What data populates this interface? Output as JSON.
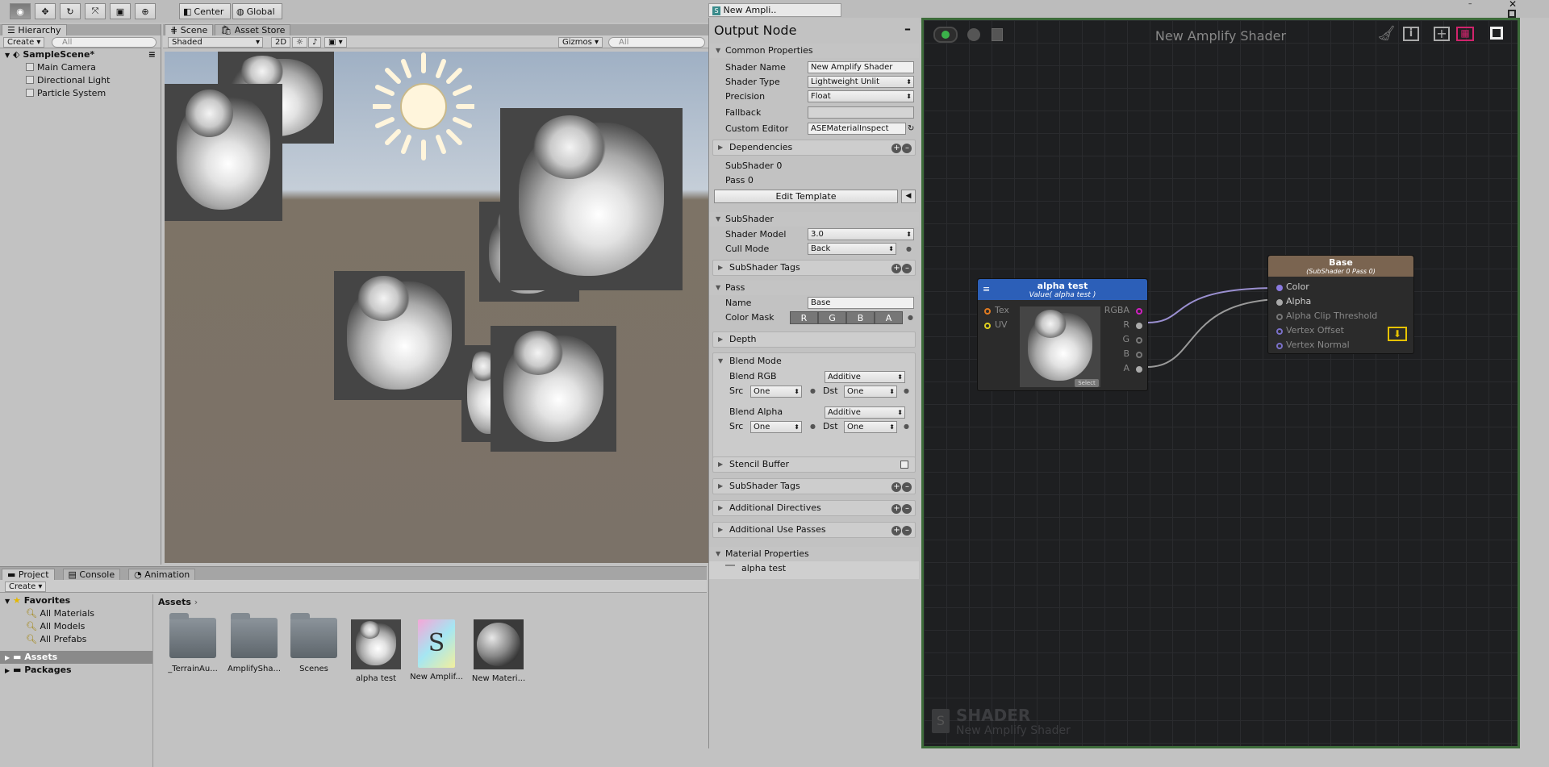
{
  "toolbar": {
    "center": "Center",
    "global": "Global"
  },
  "hierarchy": {
    "tab": "Hierarchy",
    "create": "Create",
    "search_placeholder": "All",
    "scene": "SampleScene*",
    "items": [
      "Main Camera",
      "Directional Light",
      "Particle System"
    ]
  },
  "scene": {
    "tabs": [
      "Scene",
      "Asset Store"
    ],
    "shading": "Shaded",
    "mode2d": "2D",
    "gizmos": "Gizmos",
    "search_placeholder": "All"
  },
  "ase_window": {
    "tab": "New Ampli.."
  },
  "output_node": {
    "title": "Output Node",
    "common_properties": "Common Properties",
    "shader_name_label": "Shader Name",
    "shader_name": "New Amplify Shader",
    "shader_type_label": "Shader Type",
    "shader_type": "Lightweight Unlit",
    "precision_label": "Precision",
    "precision": "Float",
    "fallback_label": "Fallback",
    "fallback": "",
    "custom_editor_label": "Custom Editor",
    "custom_editor": "ASEMaterialInspect",
    "dependencies": "Dependencies",
    "subshader_info": "SubShader 0",
    "pass_info": "Pass 0",
    "edit_template": "Edit Template",
    "subshader": "SubShader",
    "shader_model_label": "Shader Model",
    "shader_model": "3.0",
    "cull_mode_label": "Cull Mode",
    "cull_mode": "Back",
    "subshader_tags": "SubShader Tags",
    "pass": "Pass",
    "name_label": "Name",
    "name": "Base",
    "color_mask_label": "Color Mask",
    "color_mask": [
      "R",
      "G",
      "B",
      "A"
    ],
    "depth": "Depth",
    "blend_mode": "Blend Mode",
    "blend_rgb_label": "Blend RGB",
    "blend_rgb": "Additive",
    "src_label": "Src",
    "dst_label": "Dst",
    "src_rgb": "One",
    "dst_rgb": "One",
    "blend_alpha_label": "Blend Alpha",
    "blend_alpha": "Additive",
    "src_alpha": "One",
    "dst_alpha": "One",
    "stencil_buffer": "Stencil Buffer",
    "subshader_tags_2": "SubShader Tags",
    "additional_directives": "Additional Directives",
    "additional_use_passes": "Additional Use Passes",
    "material_properties": "Material Properties",
    "material_property_item": "alpha test"
  },
  "canvas": {
    "title": "New Amplify Shader",
    "watermark_title": "SHADER",
    "watermark_sub": "New Amplify Shader"
  },
  "texture_node": {
    "title": "alpha test",
    "subtitle": "Value( alpha test )",
    "inputs": [
      "Tex",
      "UV"
    ],
    "outputs": [
      "RGBA",
      "R",
      "G",
      "B",
      "A"
    ],
    "select": "Select"
  },
  "base_node": {
    "title": "Base",
    "subtitle": "(SubShader 0 Pass 0)",
    "inputs": [
      "Color",
      "Alpha",
      "Alpha Clip Threshold",
      "Vertex Offset",
      "Vertex Normal"
    ]
  },
  "project": {
    "tabs": [
      "Project",
      "Console",
      "Animation"
    ],
    "create": "Create",
    "favorites": "Favorites",
    "favorite_items": [
      "All Materials",
      "All Models",
      "All Prefabs"
    ],
    "assets_root": "Assets",
    "packages": "Packages",
    "breadcrumb": "Assets",
    "assets": [
      "_TerrainAu...",
      "AmplifySha...",
      "Scenes",
      "alpha test",
      "New Amplif...",
      "New Materi..."
    ]
  },
  "colors": {
    "node_blue": "#2c5fb8",
    "node_brown": "#7a6450",
    "wire": "#9a8fd0",
    "canvas_border": "#3d6b3a"
  }
}
